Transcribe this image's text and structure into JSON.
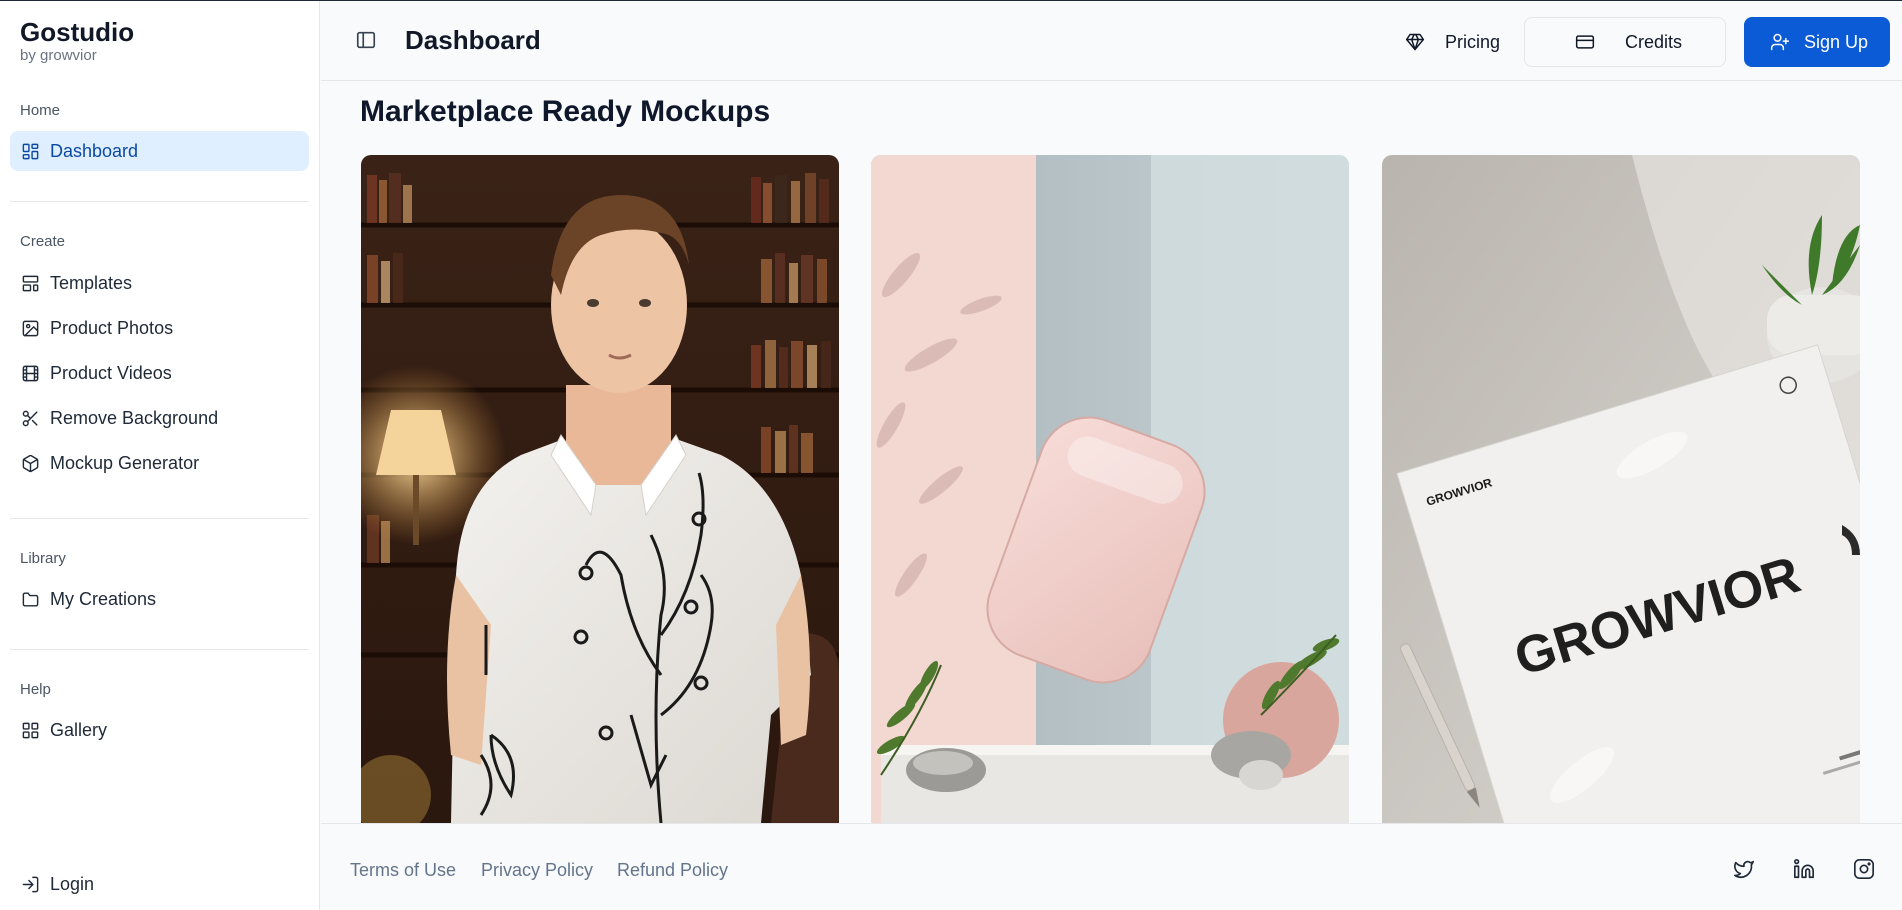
{
  "brand": {
    "title": "Gostudio",
    "subtitle": "by growvior"
  },
  "sidebar": {
    "sections": [
      {
        "label": "Home",
        "items": [
          {
            "label": "Dashboard",
            "icon": "dashboard-icon",
            "active": true
          }
        ]
      },
      {
        "label": "Create",
        "items": [
          {
            "label": "Templates",
            "icon": "templates-icon"
          },
          {
            "label": "Product Photos",
            "icon": "image-icon"
          },
          {
            "label": "Product Videos",
            "icon": "film-icon"
          },
          {
            "label": "Remove Background",
            "icon": "scissors-icon"
          },
          {
            "label": "Mockup Generator",
            "icon": "box-icon"
          }
        ]
      },
      {
        "label": "Library",
        "items": [
          {
            "label": "My Creations",
            "icon": "folder-icon"
          }
        ]
      },
      {
        "label": "Help",
        "items": [
          {
            "label": "Gallery",
            "icon": "gallery-icon"
          }
        ]
      }
    ],
    "login_label": "Login"
  },
  "header": {
    "title": "Dashboard",
    "pricing_label": "Pricing",
    "credits_label": "Credits",
    "signup_label": "Sign Up"
  },
  "main": {
    "section_title": "Marketplace Ready Mockups",
    "cards": [
      {
        "alt": "Man in embroidered white shirt mockup"
      },
      {
        "alt": "Pink power bank product mockup"
      },
      {
        "alt": "Growvior brochure mockup",
        "brand_text": "GROWVIOR",
        "small_brand_text": "GROWVIOR"
      }
    ]
  },
  "footer": {
    "links": [
      "Terms of Use",
      "Privacy Policy",
      "Refund Policy"
    ],
    "social": [
      "twitter-icon",
      "linkedin-icon",
      "instagram-icon"
    ]
  },
  "colors": {
    "accent": "#0b5ad6",
    "active_bg": "#e0efff",
    "active_text": "#0b4aa2"
  }
}
